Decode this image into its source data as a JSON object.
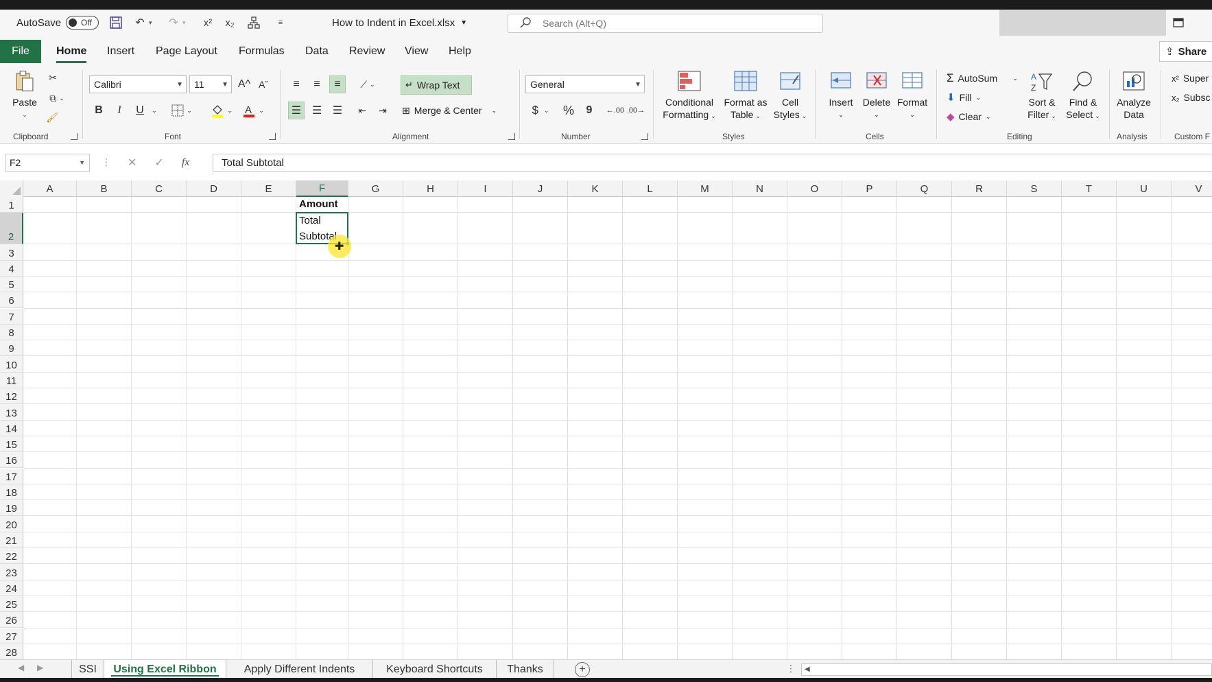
{
  "titlebar": {
    "autosave_label": "AutoSave",
    "autosave_state": "Off",
    "filename": "How to Indent in Excel.xlsx",
    "search_placeholder": "Search (Alt+Q)"
  },
  "tabs": {
    "file": "File",
    "items": [
      "Home",
      "Insert",
      "Page Layout",
      "Formulas",
      "Data",
      "Review",
      "View",
      "Help"
    ],
    "active": "Home",
    "share": "Share"
  },
  "ribbon": {
    "clipboard": {
      "label": "Clipboard",
      "paste": "Paste"
    },
    "font": {
      "label": "Font",
      "font_name": "Calibri",
      "font_size": "11",
      "bold": "B",
      "italic": "I",
      "underline": "U"
    },
    "alignment": {
      "label": "Alignment",
      "wrap_text": "Wrap Text",
      "merge_center": "Merge & Center"
    },
    "number": {
      "label": "Number",
      "format": "General",
      "currency": "$",
      "percent": "%",
      "comma": "9"
    },
    "styles": {
      "label": "Styles",
      "conditional": [
        "Conditional",
        "Formatting"
      ],
      "format_table": [
        "Format as",
        "Table"
      ],
      "cell_styles": [
        "Cell",
        "Styles"
      ]
    },
    "cells": {
      "label": "Cells",
      "insert": "Insert",
      "delete": "Delete",
      "format": "Format"
    },
    "editing": {
      "label": "Editing",
      "autosum": "AutoSum",
      "fill": "Fill",
      "clear": "Clear",
      "sort_filter": [
        "Sort &",
        "Filter"
      ],
      "find_select": [
        "Find &",
        "Select"
      ]
    },
    "analysis": {
      "label": "Analysis",
      "analyze": [
        "Analyze",
        "Data"
      ]
    },
    "custom": {
      "label": "Custom F",
      "superscript": "Super",
      "subscript": "Subsc"
    }
  },
  "formula_bar": {
    "name_box": "F2",
    "fx": "fx",
    "value": "Total Subtotal"
  },
  "grid": {
    "columns": [
      "A",
      "B",
      "C",
      "D",
      "E",
      "F",
      "G",
      "H",
      "I",
      "J",
      "K",
      "L",
      "M",
      "N",
      "O",
      "P",
      "Q",
      "R",
      "S",
      "T",
      "U",
      "V"
    ],
    "rows": [
      "1",
      "2",
      "3",
      "4",
      "5",
      "6",
      "7",
      "8",
      "9",
      "10",
      "11",
      "12",
      "13",
      "14",
      "15",
      "16",
      "17",
      "18",
      "19",
      "20",
      "21",
      "22",
      "23",
      "24",
      "25",
      "26",
      "27",
      "28"
    ],
    "selected_column": "F",
    "selected_row": "2",
    "cells": {
      "F1": "Amount",
      "F2_line1": "Total",
      "F2_line2": "Subtotal"
    }
  },
  "sheets": {
    "items": [
      "SSI",
      "Using Excel Ribbon",
      "Apply Different Indents",
      "Keyboard Shortcuts",
      "Thanks"
    ],
    "active": "Using Excel Ribbon"
  },
  "colors": {
    "excel_green": "#217346",
    "wrap_highlight": "#c6dfc7",
    "cursor_highlight": "#ffe628"
  }
}
